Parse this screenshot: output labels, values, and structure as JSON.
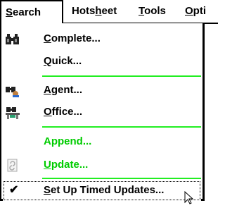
{
  "menubar": {
    "items": [
      {
        "first": "S",
        "rest": "earch"
      },
      {
        "pre": "Hots",
        "ul": "h",
        "post": "eet"
      },
      {
        "first": "T",
        "rest": "ools"
      },
      {
        "first": "O",
        "rest": "pti"
      }
    ]
  },
  "menu": {
    "items": [
      {
        "ul": "C",
        "rest": "omplete...",
        "icon": "binoculars-icon"
      },
      {
        "ul": "Q",
        "rest": "uick..."
      },
      {
        "ul": "A",
        "rest": "gent...",
        "icon": "agent-binoculars-icon"
      },
      {
        "ul": "O",
        "rest": "ffice...",
        "icon": "office-binoculars-icon"
      },
      {
        "ul": "",
        "rest": "Append..."
      },
      {
        "ul": "U",
        "rest": "pdate...",
        "icon": "update-document-icon"
      },
      {
        "ul": "S",
        "rest": "et Up Timed Updates...",
        "check": "✔"
      }
    ]
  },
  "colors": {
    "divider": "#22ee22",
    "green_text": "#00cc00",
    "border": "#000000"
  }
}
